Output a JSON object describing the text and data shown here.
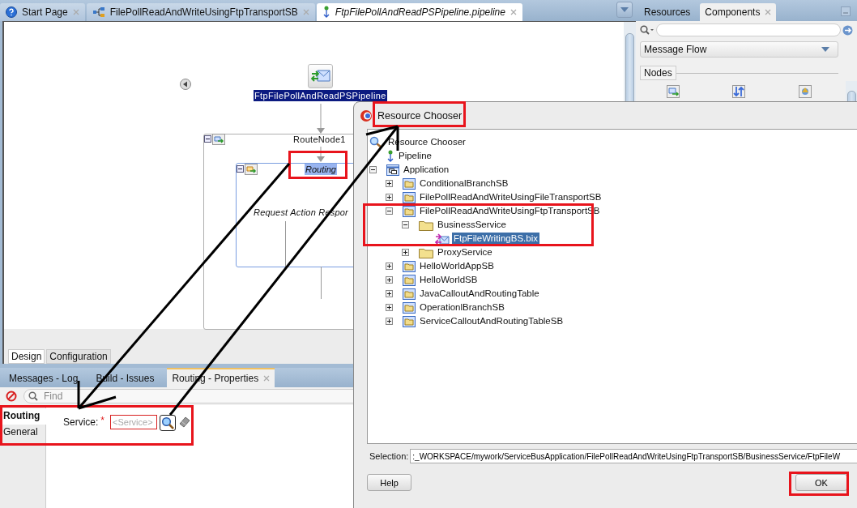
{
  "editor_tabs": [
    {
      "label": "Start Page",
      "kind": "help",
      "selected": false
    },
    {
      "label": "FilePollReadAndWriteUsingFtpTransportSB",
      "kind": "composite",
      "selected": false
    },
    {
      "label": "FtpFilePollAndReadPSPipeline.pipeline",
      "kind": "pipeline",
      "selected": true
    }
  ],
  "diagram": {
    "pipeline_label": "FtpFilePollAndReadPSPipeline",
    "route_node": "RouteNode1",
    "routing_label": "Routing",
    "stage_label": "Request Action Respor"
  },
  "design_tabs": [
    {
      "label": "Design",
      "selected": true
    },
    {
      "label": "Configuration",
      "selected": false
    }
  ],
  "log_tabs": [
    {
      "label": "Messages - Log",
      "selected": false
    },
    {
      "label": "Build - Issues",
      "selected": false
    },
    {
      "label": "Routing - Properties",
      "selected": true
    }
  ],
  "find": {
    "placeholder": "Find"
  },
  "properties": {
    "sections": [
      {
        "label": "Routing",
        "selected": true
      },
      {
        "label": "General",
        "selected": false
      }
    ],
    "service_label": "Service:",
    "required_mark": "*",
    "service_placeholder": "<Service>"
  },
  "right_panel": {
    "tabs": [
      {
        "label": "Resources",
        "selected": false
      },
      {
        "label": "Components",
        "selected": true
      }
    ],
    "palette": "Message Flow",
    "section": "Nodes"
  },
  "dialog": {
    "title": "Resource Chooser",
    "tree": [
      {
        "label": "Resource Chooser",
        "kind": "search",
        "selected": false,
        "children": [
          {
            "label": "Pipeline",
            "kind": "pipeline",
            "selected": false
          },
          {
            "label": "Application",
            "kind": "application",
            "selected": false,
            "expanded": true,
            "children": [
              {
                "label": "ConditionalBranchSB",
                "kind": "project",
                "selected": false,
                "expanded": false
              },
              {
                "label": "FilePollReadAndWriteUsingFileTransportSB",
                "kind": "project",
                "selected": false,
                "expanded": false
              },
              {
                "label": "FilePollReadAndWriteUsingFtpTransportSB",
                "kind": "project",
                "selected": false,
                "expanded": true,
                "children": [
                  {
                    "label": "BusinessService",
                    "kind": "folder",
                    "selected": false,
                    "expanded": true,
                    "children": [
                      {
                        "label": "FtpFileWritingBS.bix",
                        "kind": "business-service",
                        "selected": true
                      }
                    ]
                  },
                  {
                    "label": "ProxyService",
                    "kind": "folder",
                    "selected": false,
                    "expanded": false
                  }
                ]
              },
              {
                "label": "HelloWorldAppSB",
                "kind": "project",
                "selected": false,
                "expanded": false
              },
              {
                "label": "HelloWorldSB",
                "kind": "project",
                "selected": false,
                "expanded": false
              },
              {
                "label": "JavaCalloutAndRoutingTable",
                "kind": "project",
                "selected": false,
                "expanded": false
              },
              {
                "label": "OperationlBranchSB",
                "kind": "project",
                "selected": false,
                "expanded": false
              },
              {
                "label": "ServiceCalloutAndRoutingTableSB",
                "kind": "project",
                "selected": false,
                "expanded": false
              }
            ]
          }
        ]
      }
    ],
    "selection_label": "Selection:",
    "selection_value": ":_WORKSPACE/mywork/ServiceBusApplication/FilePollReadAndWriteUsingFtpTransportSB/BusinessService/FtpFileW",
    "buttons": [
      "Help",
      "OK"
    ]
  }
}
